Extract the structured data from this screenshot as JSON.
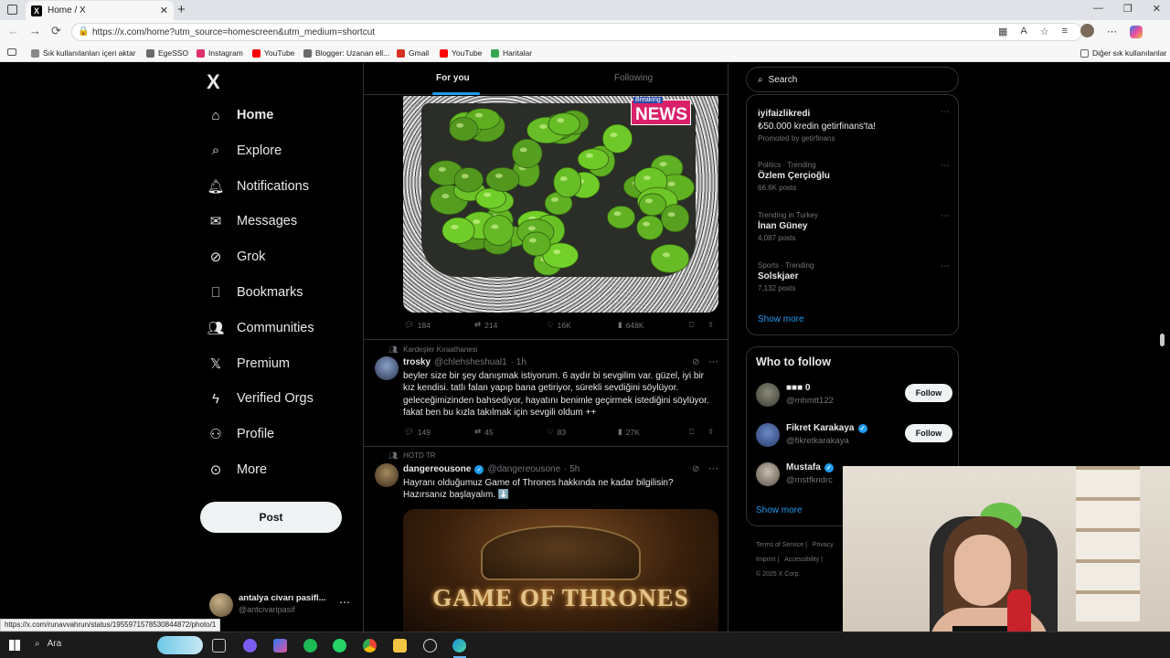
{
  "browser": {
    "tab_title": "Home / X",
    "url": "https://x.com/home?utm_source=homescreen&utm_medium=shortcut",
    "bookmarks": [
      {
        "label": "Sık kullanılanları içeri aktar",
        "color": "#888888"
      },
      {
        "label": "EgeSSO",
        "color": "#6a6a6a"
      },
      {
        "label": "Instagram",
        "color": "#e1306c"
      },
      {
        "label": "YouTube",
        "color": "#ff0000"
      },
      {
        "label": "Blogger: Uzanan ell...",
        "color": "#6a6a6a"
      },
      {
        "label": "Gmail",
        "color": "#d93025"
      },
      {
        "label": "YouTube",
        "color": "#ff0000"
      },
      {
        "label": "Haritalar",
        "color": "#34a853"
      }
    ],
    "other_favorites": "Diğer sık kullanılanlar",
    "status_url": "https://x.com/runavvahrun/status/1955971578530844872/photo/1"
  },
  "nav": {
    "logo": "X",
    "items": [
      {
        "label": "Home",
        "icon": "home-icon",
        "active": true
      },
      {
        "label": "Explore",
        "icon": "search-icon"
      },
      {
        "label": "Notifications",
        "icon": "bell-icon"
      },
      {
        "label": "Messages",
        "icon": "envelope-icon"
      },
      {
        "label": "Grok",
        "icon": "grok-icon"
      },
      {
        "label": "Bookmarks",
        "icon": "bookmark-icon"
      },
      {
        "label": "Communities",
        "icon": "communities-icon"
      },
      {
        "label": "Premium",
        "icon": "x-icon"
      },
      {
        "label": "Verified Orgs",
        "icon": "lightning-icon"
      },
      {
        "label": "Profile",
        "icon": "person-icon"
      },
      {
        "label": "More",
        "icon": "more-circle-icon"
      }
    ],
    "post_label": "Post",
    "account": {
      "name": "antalya civarı pasifl...",
      "handle": "@antcivaripasif"
    }
  },
  "timeline": {
    "tabs": [
      {
        "label": "For you",
        "active": true
      },
      {
        "label": "Following"
      }
    ],
    "image_badge": "NEWS",
    "image_badge_small": "Breaking",
    "tweet1_actions": {
      "replies": "184",
      "reposts": "214",
      "likes": "16K",
      "views": "648K"
    },
    "tweet2": {
      "context": "Kardeşler Kıraathanesi",
      "name": "trosky",
      "handle": "@chlehsheshual1",
      "time": "· 1h",
      "lines": [
        "beyler size bir şey danışmak istiyorum. 6 aydır bi sevgilim var. güzel, iyi bir",
        "kız kendisi. tatlı falan yapıp bana getiriyor, sürekli sevdiğini söylüyor.",
        "geleceğimizinden bahsediyor, hayatını benimle geçirmek istediğini söylüyor.",
        "fakat ben bu kızla takılmak için sevgili oldum ++"
      ],
      "actions": {
        "replies": "149",
        "reposts": "45",
        "likes": "83",
        "views": "27K"
      }
    },
    "tweet3": {
      "context": "HOTD TR",
      "name": "dangereousone",
      "handle": "@dangereousone",
      "time": "· 5h",
      "lines": [
        "Hayranı olduğumuz Game of Thrones hakkında ne kadar bilgilisin?",
        "Hazırsanız başlayalım. ⬇️"
      ],
      "image_title": "GAME OF THRONES"
    }
  },
  "right": {
    "search_placeholder": "Search",
    "trends": [
      {
        "meta": "",
        "name": "iyifaizlikredi",
        "line2": "₺50.000 kredin getirfinans'ta!",
        "cnt": "Promoted by getirfinans"
      },
      {
        "meta": "Politics · Trending",
        "name": "Özlem Çerçioğlu",
        "cnt": "66.6K posts"
      },
      {
        "meta": "Trending in Turkey",
        "name": "İnan Güney",
        "cnt": "4,087 posts"
      },
      {
        "meta": "Sports · Trending",
        "name": "Solskjaer",
        "cnt": "7,132 posts"
      }
    ],
    "show_more": "Show more",
    "who_title": "Who to follow",
    "who": [
      {
        "name": "■■■ 0",
        "handle": "@mhmtt122",
        "follow": "Follow",
        "verified": false
      },
      {
        "name": "Fikret Karakaya",
        "handle": "@fikretkarakaya",
        "follow": "Follow",
        "verified": true
      },
      {
        "name": "Mustafa",
        "handle": "@mstfkndrc",
        "follow": "",
        "verified": true
      }
    ],
    "who_show_more": "Show more",
    "footer": [
      "Terms of Service |",
      "Privacy",
      "Imprint |",
      "Accessibility |",
      "© 2025 X Corp."
    ]
  },
  "taskbar": {
    "search_label": "Ara"
  }
}
